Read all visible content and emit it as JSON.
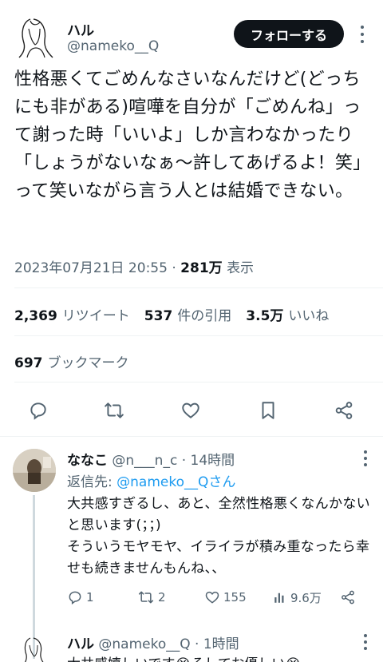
{
  "tweet": {
    "author_name": "ハル",
    "author_handle": "@nameko__Q",
    "follow_label": "フォローする",
    "text": "性格悪くてごめんなさいなんだけど(どっちにも非がある)喧嘩を自分が「ごめんね」って謝った時「いいよ」しか言わなかったり「しょうがないなぁ〜許してあげるよ！笑」って笑いながら言う人とは結婚できない。",
    "datetime": "2023年07月21日 20:55",
    "views_count": "281万",
    "views_label": "表示",
    "retweets_count": "2,369",
    "retweets_label": "リツイート",
    "quotes_count": "537",
    "quotes_label": "件の引用",
    "likes_count": "3.5万",
    "likes_label": "いいね",
    "bookmarks_count": "697",
    "bookmarks_label": "ブックマーク"
  },
  "actions": {
    "icons": [
      "reply-icon",
      "retweet-icon",
      "like-icon",
      "bookmark-icon",
      "share-icon"
    ]
  },
  "reply": {
    "name": "ななこ",
    "handle": "@n___n_c",
    "separator": "·",
    "time": "14時間",
    "reply_to_label": "返信先: ",
    "reply_to_handle": "@nameko__Qさん",
    "text": "大共感すぎるし、あと、全然性格悪くなんかないと思います(；；)\nそういうモヤモヤ、イライラが積み重なったら幸せも続きませんもんね、、",
    "replies": "1",
    "retweets": "2",
    "likes": "155",
    "views": "9.6万"
  },
  "reply2": {
    "name": "ハル",
    "handle": "@nameko__Q",
    "separator": "·",
    "time": "1時間",
    "text": "大共感嬉しいです😭そしてお優しい😭"
  },
  "colors": {
    "text": "#0f1419",
    "secondary": "#536471",
    "link": "#1d9bf0",
    "divider": "#eff3f4"
  }
}
